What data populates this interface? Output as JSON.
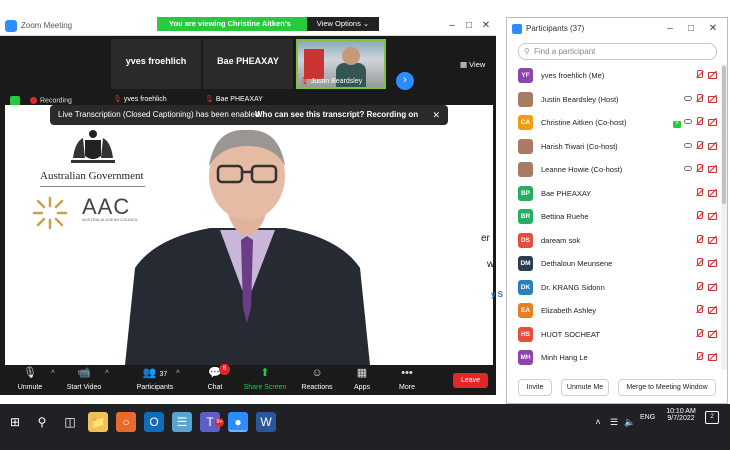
{
  "zoom_window": {
    "title": "Zoom Meeting",
    "viewing_banner": "You are viewing Christine Aitken's screen",
    "view_options": "View Options ⌄",
    "view_button": "View",
    "recording": "Recording"
  },
  "thumbnails": [
    {
      "name": "yves froehlich",
      "label": "yves froehlich"
    },
    {
      "name": "Bae PHEAXAY",
      "label": "Bae PHEAXAY"
    },
    {
      "name": "",
      "label": "Justin Beardsley"
    }
  ],
  "caption_banner": {
    "text": "Live Transcription (Closed Captioning) has been enabled",
    "who_link": "Who can see this transcript? Recording on",
    "close": "✕"
  },
  "shared_screen": {
    "gov_text": "Australian Government",
    "aac_title": "AAC",
    "aac_subtitle": "AUSTRALIA-ASEAN COUNCIL",
    "side_text1": "er",
    "side_text2": "w",
    "side_text3": "y S"
  },
  "controls": {
    "unmute": "Unmute",
    "start_video": "Start Video",
    "participants": "Participants",
    "participants_count": "37",
    "chat": "Chat",
    "chat_badge": "8",
    "share_screen": "Share Screen",
    "reactions": "Reactions",
    "apps": "Apps",
    "more": "More",
    "leave": "Leave"
  },
  "participants_panel": {
    "title": "Participants (37)",
    "search_placeholder": "Find a participant",
    "participants": [
      {
        "initials": "YF",
        "name": "yves froehlich (Me)",
        "color": "#8e44ad",
        "photo": false,
        "cc": false,
        "share": false
      },
      {
        "initials": "",
        "name": "Justin Beardsley (Host)",
        "color": "#a87b63",
        "photo": true,
        "cc": true,
        "share": false
      },
      {
        "initials": "CA",
        "name": "Christine Aitken (Co-host)",
        "color": "#f39c12",
        "photo": false,
        "cc": true,
        "share": true
      },
      {
        "initials": "",
        "name": "Harish Tiwari (Co-host)",
        "color": "#a87b63",
        "photo": true,
        "cc": true,
        "share": false
      },
      {
        "initials": "",
        "name": "Leanne Howie (Co-host)",
        "color": "#a87b63",
        "photo": true,
        "cc": true,
        "share": false
      },
      {
        "initials": "BP",
        "name": "Bae PHEAXAY",
        "color": "#27ae60",
        "photo": false,
        "cc": false,
        "share": false
      },
      {
        "initials": "BR",
        "name": "Bettina Ruehe",
        "color": "#27ae60",
        "photo": false,
        "cc": false,
        "share": false
      },
      {
        "initials": "DS",
        "name": "daream sok",
        "color": "#e74c3c",
        "photo": false,
        "cc": false,
        "share": false
      },
      {
        "initials": "DM",
        "name": "Dethaloun Meunsene",
        "color": "#2c3e50",
        "photo": false,
        "cc": false,
        "share": false
      },
      {
        "initials": "DK",
        "name": "Dr. KRANG Sidonn",
        "color": "#2980b9",
        "photo": false,
        "cc": false,
        "share": false
      },
      {
        "initials": "EA",
        "name": "Elizabeth Ashley",
        "color": "#e67e22",
        "photo": false,
        "cc": false,
        "share": false
      },
      {
        "initials": "HS",
        "name": "HUOT SOCHEAT",
        "color": "#e74c3c",
        "photo": false,
        "cc": false,
        "share": false
      },
      {
        "initials": "MH",
        "name": "Minh Hang Le",
        "color": "#8e44ad",
        "photo": false,
        "cc": false,
        "share": false
      }
    ],
    "invite": "Invite",
    "unmute_me": "Unmute Me",
    "merge": "Merge to Meeting Window"
  },
  "taskbar": {
    "time": "10:10 AM",
    "date": "9/7/2022",
    "language": "ENG",
    "notifications": "2",
    "teams_badge": "9+"
  }
}
